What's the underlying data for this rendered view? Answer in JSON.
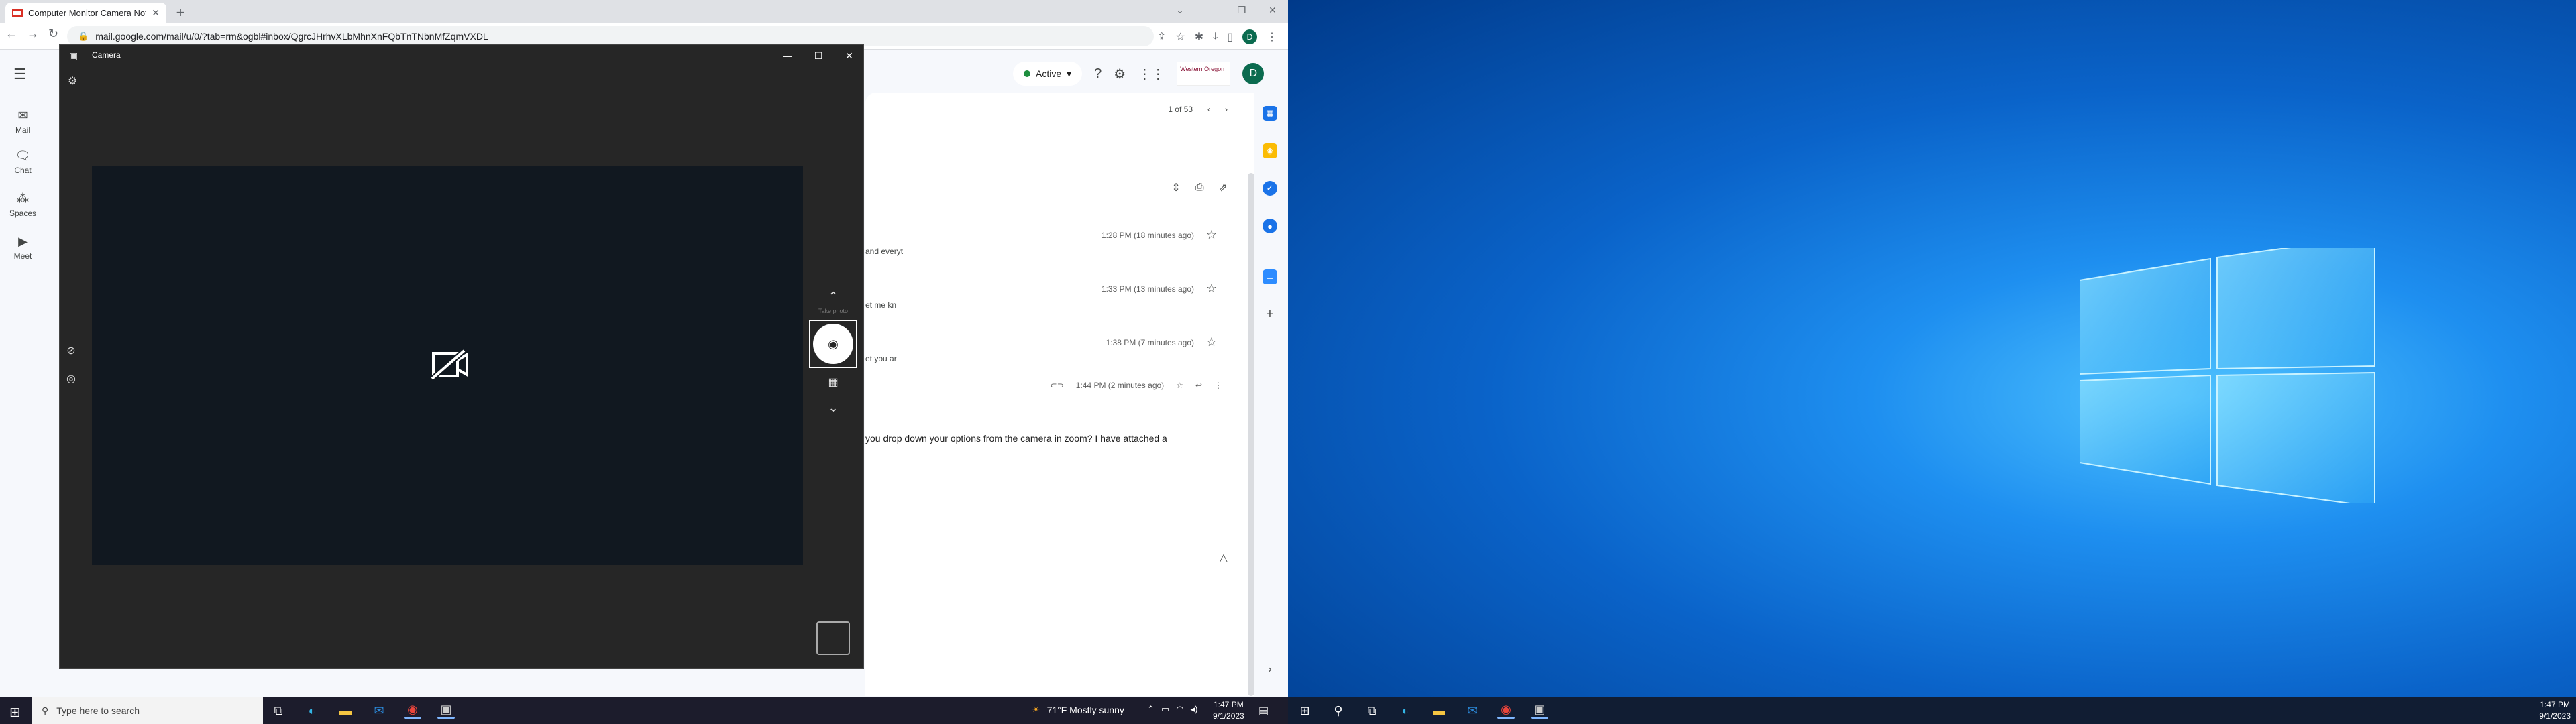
{
  "browser": {
    "tab_title": "Computer Monitor Camera Not...",
    "url": "mail.google.com/mail/u/0/?tab=rm&ogbl#inbox/QgrcJHrhvXLbMhnXnFQbTnTNbnMfZqmVXDL"
  },
  "gmail": {
    "rail": [
      {
        "label": "Mail",
        "icon": "mail-icon"
      },
      {
        "label": "Chat",
        "icon": "chat-icon"
      },
      {
        "label": "Spaces",
        "icon": "spaces-icon"
      },
      {
        "label": "Meet",
        "icon": "meet-icon"
      }
    ],
    "status": "Active",
    "org_logo_text": "Western Oregon",
    "avatar_letter": "D",
    "pager": "1 of 53",
    "messages": [
      {
        "snippet": "and everyt",
        "time": "1:28 PM (18 minutes ago)"
      },
      {
        "snippet": "et me kn",
        "time": "1:33 PM (13 minutes ago)"
      },
      {
        "snippet": "et you ar",
        "time": "1:38 PM (7 minutes ago)"
      }
    ],
    "expanded": {
      "time": "1:44 PM (2 minutes ago)",
      "body": "you drop down your options from the camera in zoom? I have attached a"
    }
  },
  "camera": {
    "title": "Camera",
    "mode_label": "Take photo"
  },
  "taskbar_left": {
    "search_placeholder": "Type here to search",
    "weather": "71°F  Mostly sunny",
    "time": "1:47 PM",
    "date": "9/1/2023"
  },
  "taskbar_right": {
    "time": "1:47 PM",
    "date": "9/1/2023"
  }
}
